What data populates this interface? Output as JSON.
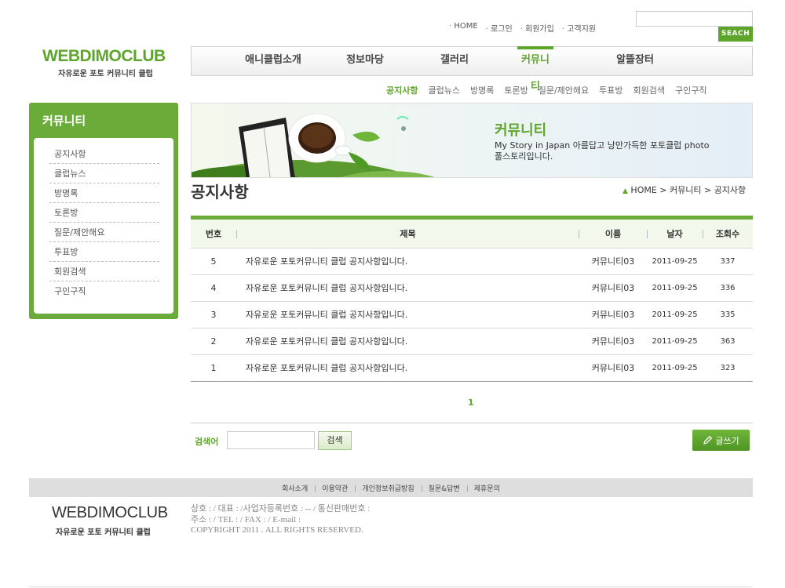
{
  "top_links": [
    "HOME",
    "로그인",
    "회원가입",
    "고객지원"
  ],
  "search": {
    "button": "SEACH",
    "value": ""
  },
  "logo": {
    "name": "WEBDIMOCLUB",
    "tagline": "자유로운 포토 커뮤니티 클럽"
  },
  "main_nav": [
    {
      "label": "애니클럽소개",
      "active": false
    },
    {
      "label": "정보마당",
      "active": false
    },
    {
      "label": "갤러리",
      "active": false
    },
    {
      "label": "커뮤니티",
      "active": true
    },
    {
      "label": "알뜰장터",
      "active": false
    }
  ],
  "sub_nav": [
    "공지사항",
    "클럽뉴스",
    "방명록",
    "토론방",
    "질문/제안해요",
    "투표방",
    "회원검색",
    "구인구직"
  ],
  "sidebar": {
    "title": "커뮤니티",
    "items": [
      "공지사항",
      "클럽뉴스",
      "방명록",
      "토론방",
      "질문/제안해요",
      "투표방",
      "회원검색",
      "구인구직"
    ]
  },
  "banner": {
    "title": "커뮤니티",
    "desc_line1": "My Story in Japan 아름답고 낭만가득한  포토클럽 photo",
    "desc_line2": "풀스토리입니다."
  },
  "page_title": "공지사항",
  "breadcrumb": "HOME > 커뮤니티 > 공지사항",
  "table": {
    "headers": {
      "no": "번호",
      "subject": "제목",
      "name": "이름",
      "date": "날자",
      "views": "조회수"
    },
    "rows": [
      {
        "no": "5",
        "subject": "자유로운 포토커뮤니티 클럽 공지사항입니다.",
        "name": "커뮤니티03",
        "date": "2011-09-25",
        "views": "337"
      },
      {
        "no": "4",
        "subject": "자유로운 포토커뮤니티 클럽 공지사항입니다.",
        "name": "커뮤니티03",
        "date": "2011-09-25",
        "views": "336"
      },
      {
        "no": "3",
        "subject": "자유로운 포토커뮤니티 클럽 공지사항입니다.",
        "name": "커뮤니티03",
        "date": "2011-09-25",
        "views": "335"
      },
      {
        "no": "2",
        "subject": "자유로운 포토커뮤니티 클럽 공지사항입니다.",
        "name": "커뮤니티03",
        "date": "2011-09-25",
        "views": "363"
      },
      {
        "no": "1",
        "subject": "자유로운 포토커뮤니티 클럽 공지사항입니다.",
        "name": "커뮤니티03",
        "date": "2011-09-25",
        "views": "323"
      }
    ]
  },
  "pagination": {
    "current": "1"
  },
  "board_search": {
    "label": "검색어",
    "button": "검색",
    "value": ""
  },
  "write_button": "글쓰기",
  "footer": {
    "links": [
      "회사소개",
      "이용약관",
      "개인정보취급방침",
      "질문&답변",
      "제휴문의"
    ],
    "logo_name": "WEBDIMOCLUB",
    "logo_tagline": "자유로운 포토 커뮤니티 클럽",
    "info_line1": "상호 : / 대표 : /사업자등록번호 : -- / 통신판매번호 :",
    "info_line2": "주소 : / TEL : / FAX : / E-mail :",
    "copyright": "COPYRIGHT 2011 . ALL RIGHTS RESERVED."
  },
  "colors": {
    "accent": "#5ea62b",
    "sidebar": "#6aab3a",
    "footer_bar": "#dedede"
  },
  "icons": {
    "breadcrumb": "home-arrow-icon",
    "write": "pencil-icon"
  }
}
